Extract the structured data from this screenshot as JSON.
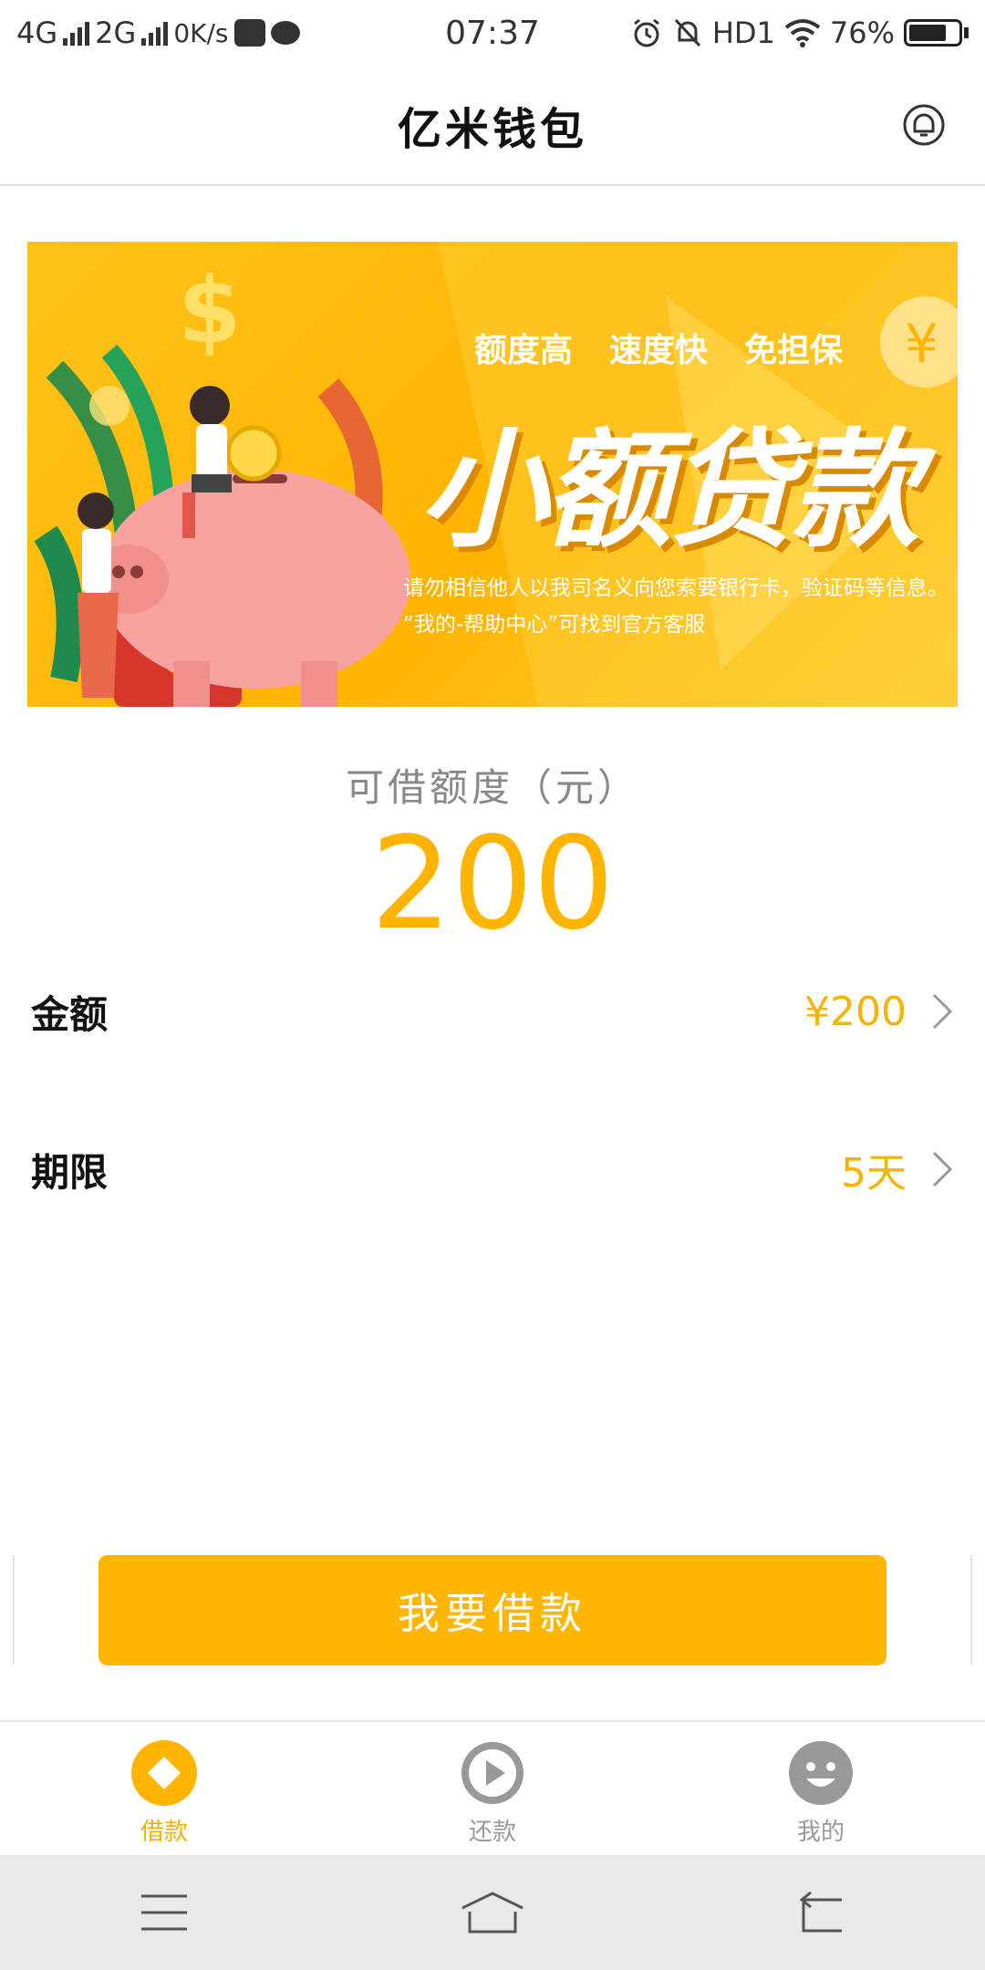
{
  "status_bar": {
    "net1": "4G",
    "net2": "2G",
    "speed": "0K/s",
    "time": "07:37",
    "hd": "HD1",
    "battery": "76%",
    "battery_level": 0.76
  },
  "header": {
    "title": "亿米钱包",
    "bell_icon": "bell-icon"
  },
  "banner": {
    "tags": [
      "额度高",
      "速度快",
      "免担保"
    ],
    "headline": "小额贷款",
    "notice_line1": "请勿相信他人以我司名义向您索要银行卡，验证码等信息。",
    "notice_line2": "“我的-帮助中心”可找到官方客服",
    "accent": "#ffb400"
  },
  "credit": {
    "label": "可借额度（元）",
    "amount": "200",
    "color": "#ffb400"
  },
  "rows": [
    {
      "label": "金额",
      "value": "¥200"
    },
    {
      "label": "期限",
      "value": "5天"
    }
  ],
  "button": {
    "label": "我要借款",
    "color": "#ffb600"
  },
  "tabs": [
    {
      "label": "借款",
      "icon": "diamond-icon",
      "active": true
    },
    {
      "label": "还款",
      "icon": "play-icon",
      "active": false
    },
    {
      "label": "我的",
      "icon": "smiley-icon",
      "active": false
    }
  ],
  "system_nav": {
    "menu_icon": "menu-icon",
    "home_icon": "home-icon",
    "back_icon": "back-icon"
  }
}
